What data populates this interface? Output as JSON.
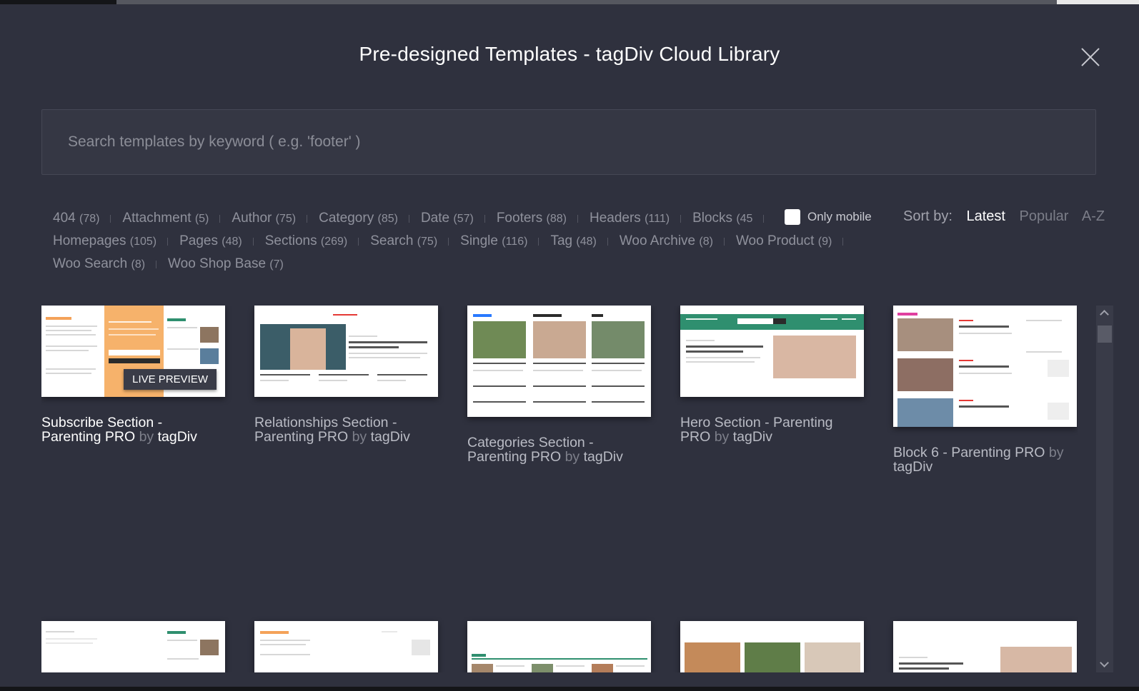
{
  "modal": {
    "title": "Pre-designed Templates - tagDiv Cloud Library",
    "close_icon": "close-icon"
  },
  "search": {
    "placeholder": "Search templates by keyword ( e.g. 'footer' )"
  },
  "filters": [
    {
      "label": "404",
      "count": "(78)"
    },
    {
      "label": "Attachment",
      "count": "(5)"
    },
    {
      "label": "Author",
      "count": "(75)"
    },
    {
      "label": "Category",
      "count": "(85)"
    },
    {
      "label": "Date",
      "count": "(57)"
    },
    {
      "label": "Footers",
      "count": "(88)"
    },
    {
      "label": "Headers",
      "count": "(111)"
    },
    {
      "label": "Blocks",
      "count": "(45"
    },
    {
      "label": "Homepages",
      "count": "(105)"
    },
    {
      "label": "Pages",
      "count": "(48)"
    },
    {
      "label": "Sections",
      "count": "(269)"
    },
    {
      "label": "Search",
      "count": "(75)"
    },
    {
      "label": "Single",
      "count": "(116)"
    },
    {
      "label": "Tag",
      "count": "(48)"
    },
    {
      "label": "Woo Archive",
      "count": "(8)"
    },
    {
      "label": "Woo Product",
      "count": "(9)"
    },
    {
      "label": "Woo Search",
      "count": "(8)"
    },
    {
      "label": "Woo Shop Base",
      "count": "(7)"
    }
  ],
  "only_mobile": {
    "label": "Only mobile",
    "checked": false
  },
  "sort": {
    "label": "Sort by:",
    "options": [
      "Latest",
      "Popular",
      "A-Z"
    ],
    "active": "Latest"
  },
  "live_preview_label": "LIVE PREVIEW",
  "templates": [
    {
      "name": "Subscribe Section - Parenting PRO",
      "by": "by",
      "author": "tagDiv"
    },
    {
      "name": "Relationships Section - Parenting PRO",
      "by": "by",
      "author": "tagDiv"
    },
    {
      "name": "Categories Section - Parenting PRO",
      "by": "by",
      "author": "tagDiv"
    },
    {
      "name": "Hero Section - Parenting PRO",
      "by": "by",
      "author": "tagDiv"
    },
    {
      "name": "Block 6 - Parenting PRO",
      "by": "by",
      "author": "tagDiv"
    }
  ],
  "colors": {
    "background": "#2f313e",
    "accent_orange": "#f4a259",
    "accent_red": "#e53935",
    "accent_green": "#2f8f6f"
  }
}
